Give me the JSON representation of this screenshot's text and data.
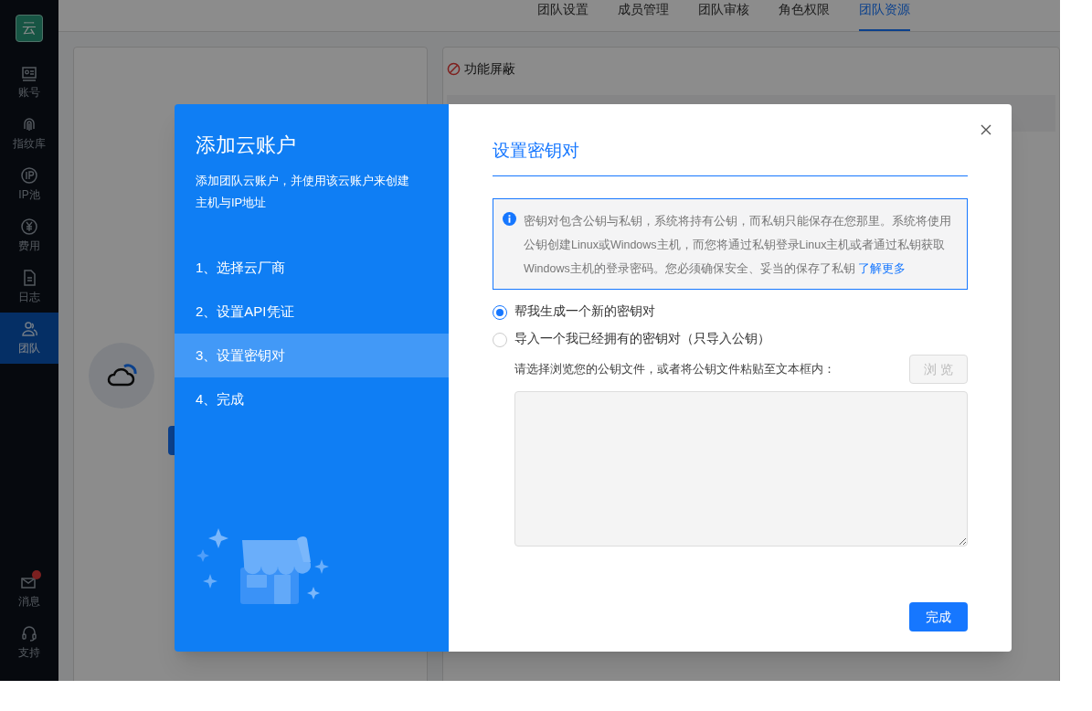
{
  "sidebar": {
    "logo": "云",
    "items": [
      {
        "label": "账号",
        "selected": false
      },
      {
        "label": "指纹库",
        "selected": false
      },
      {
        "label": "IP池",
        "selected": false
      },
      {
        "label": "费用",
        "selected": false
      },
      {
        "label": "日志",
        "selected": false
      },
      {
        "label": "团队",
        "selected": true
      }
    ],
    "bottom_items": [
      {
        "label": "消息",
        "badge": true
      },
      {
        "label": "支持",
        "badge": false
      }
    ]
  },
  "tabs": [
    {
      "label": "团队设置",
      "selected": false
    },
    {
      "label": "成员管理",
      "selected": false
    },
    {
      "label": "团队审核",
      "selected": false
    },
    {
      "label": "角色权限",
      "selected": false
    },
    {
      "label": "团队资源",
      "selected": true
    }
  ],
  "right_card": {
    "title": "功能屏蔽"
  },
  "modal": {
    "title": "添加云账户",
    "subtitle": "添加团队云账户，并使用该云账户来创建主机与IP地址",
    "steps": [
      {
        "label": "1、选择云厂商",
        "selected": false
      },
      {
        "label": "2、设置API凭证",
        "selected": false
      },
      {
        "label": "3、设置密钥对",
        "selected": true
      },
      {
        "label": "4、完成",
        "selected": false
      }
    ],
    "panel_title": "设置密钥对",
    "info": {
      "text": "密钥对包含公钥与私钥，系统将持有公钥，而私钥只能保存在您那里。系统将使用公钥创建Linux或Windows主机，而您将通过私钥登录Linux主机或者通过私钥获取Windows主机的登录密码。您必须确保安全、妥当的保存了私钥",
      "link": "了解更多"
    },
    "options": [
      {
        "label": "帮我生成一个新的密钥对",
        "selected": true
      },
      {
        "label": "导入一个我已经拥有的密钥对（只导入公钥）",
        "selected": false
      }
    ],
    "hint": "请选择浏览您的公钥文件，或者将公钥文件粘贴至文本框内：",
    "browse_button": {
      "label": "浏 览",
      "disabled": true
    },
    "done_button": "完成"
  }
}
